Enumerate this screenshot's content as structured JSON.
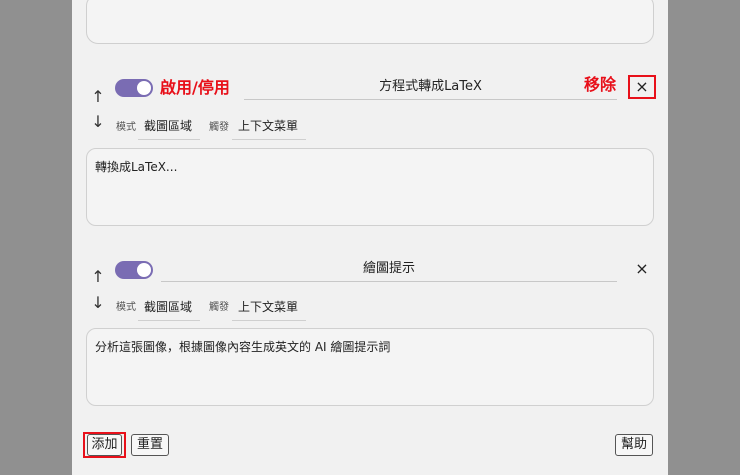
{
  "rule1": {
    "enabled": true,
    "name": "方程式轉成LaTeX",
    "mode_label": "模式",
    "mode_value": "截圖區域",
    "trigger_label": "觸發",
    "trigger_value": "上下文菜單",
    "prompt": "轉換成LaTeX..."
  },
  "rule2": {
    "enabled": true,
    "name": "繪圖提示",
    "mode_label": "模式",
    "mode_value": "截圖區域",
    "trigger_label": "觸發",
    "trigger_value": "上下文菜單",
    "prompt": "分析這張圖像，根據圖像內容生成英文的 AI 繪圖提示詞"
  },
  "annotations": {
    "toggle_note": "啟用/停用",
    "remove_note": "移除"
  },
  "footer": {
    "add_label": "添加",
    "reset_label": "重置",
    "help_label": "幫助"
  },
  "icons": {
    "up": "↑",
    "down": "↓",
    "close": "×"
  },
  "colors": {
    "toggle": "#7a6cb3",
    "annotation": "#e8101a"
  }
}
